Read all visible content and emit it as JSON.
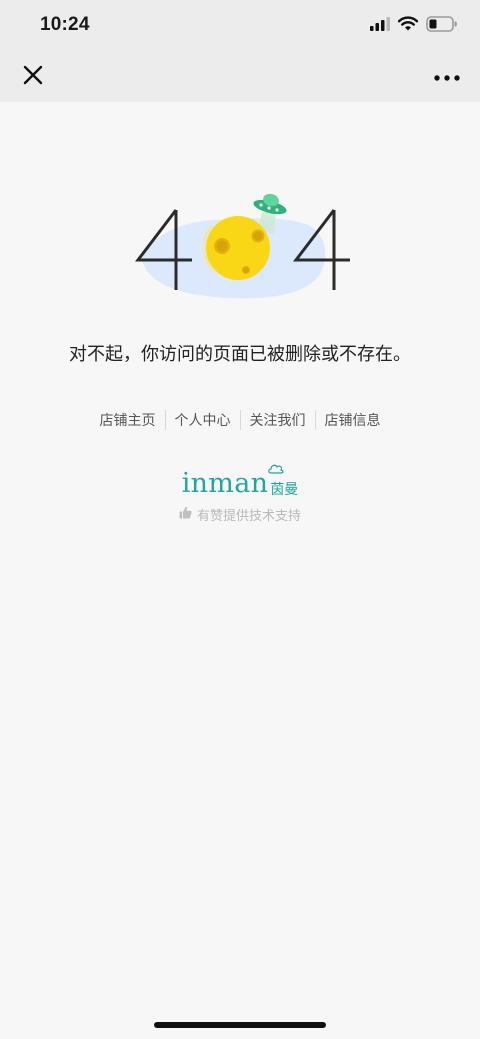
{
  "status_bar": {
    "time": "10:24",
    "icons": [
      "cellular-signal-icon",
      "wifi-icon",
      "battery-icon"
    ]
  },
  "nav_bar": {
    "close_icon": "close-icon",
    "more_icon": "more-icon"
  },
  "error": {
    "code": "404",
    "message": "对不起，你访问的页面已被删除或不存在。"
  },
  "links": [
    {
      "label": "店铺主页"
    },
    {
      "label": "个人中心"
    },
    {
      "label": "关注我们"
    },
    {
      "label": "店铺信息"
    }
  ],
  "brand": {
    "name_en": "inman",
    "name_cn": "茵曼",
    "color": "#22a7a0"
  },
  "support": {
    "text": "有赞提供技术支持",
    "icon": "thumbs-up-icon"
  }
}
